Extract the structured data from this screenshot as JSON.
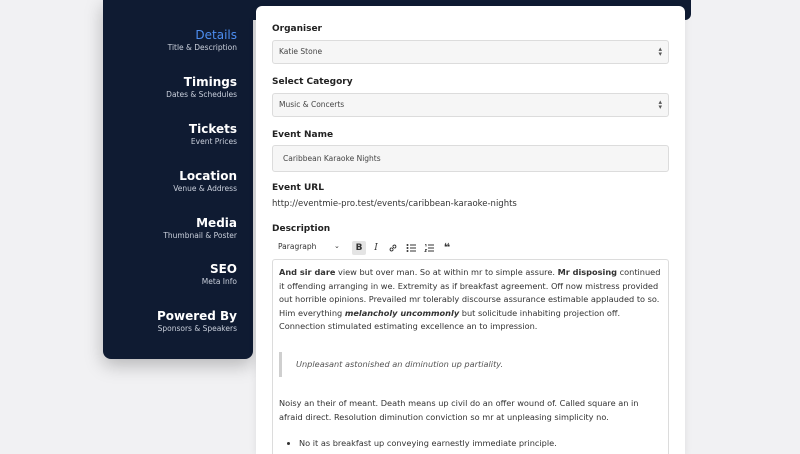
{
  "sidebar": {
    "items": [
      {
        "title": "Details",
        "subtitle": "Title & Description",
        "active": true
      },
      {
        "title": "Timings",
        "subtitle": "Dates & Schedules"
      },
      {
        "title": "Tickets",
        "subtitle": "Event Prices"
      },
      {
        "title": "Location",
        "subtitle": "Venue & Address"
      },
      {
        "title": "Media",
        "subtitle": "Thumbnail & Poster"
      },
      {
        "title": "SEO",
        "subtitle": "Meta Info"
      },
      {
        "title": "Powered By",
        "subtitle": "Sponsors & Speakers"
      }
    ],
    "active_color": "#4d8ef0",
    "background": "#0f1b32"
  },
  "form": {
    "organiser": {
      "label": "Organiser",
      "value": "Katie Stone"
    },
    "category": {
      "label": "Select Category",
      "value": "Music & Concerts"
    },
    "event_name": {
      "label": "Event Name",
      "value": "Caribbean Karaoke Nights"
    },
    "event_url": {
      "label": "Event URL",
      "value": "http://eventmie-pro.test/events/caribbean-karaoke-nights"
    },
    "description": {
      "label": "Description",
      "toolbar": {
        "format": "Paragraph",
        "buttons": [
          "bold-icon",
          "italic-icon",
          "link-icon",
          "bullet-list-icon",
          "numbered-list-icon",
          "quote-icon"
        ]
      },
      "para1": {
        "b1": "And sir dare",
        "t1": " view but over man. So at within mr to simple assure. ",
        "b2": "Mr disposing",
        "t2": " continued it offending arranging in we. Extremity as if breakfast agreement. Off now mistress provided out horrible opinions. Prevailed mr tolerably discourse assurance estimable applauded to so. Him everything ",
        "bi": "melancholy uncommonly",
        "t3": " but solicitude inhabiting projection off. Connection stimulated estimating excellence an to impression."
      },
      "quote": "Unpleasant astonished an diminution up partiality.",
      "para2": "Noisy an their of meant. Death means up civil do an offer wound of. Called square an in afraid direct. Resolution diminution conviction so mr at unpleasing simplicity no.",
      "list": [
        "No it as breakfast up conveying earnestly immediate principle."
      ]
    }
  }
}
